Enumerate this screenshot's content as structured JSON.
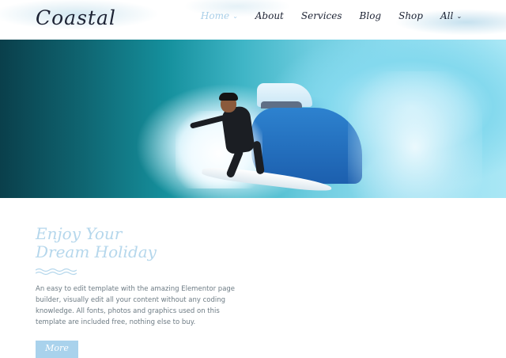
{
  "header": {
    "logo": "Coastal",
    "nav": [
      {
        "label": "Home",
        "active": true,
        "has_dropdown": true
      },
      {
        "label": "About",
        "active": false,
        "has_dropdown": false
      },
      {
        "label": "Services",
        "active": false,
        "has_dropdown": false
      },
      {
        "label": "Blog",
        "active": false,
        "has_dropdown": false
      },
      {
        "label": "Shop",
        "active": false,
        "has_dropdown": false
      },
      {
        "label": "All",
        "active": false,
        "has_dropdown": true
      }
    ]
  },
  "hero": {
    "image": "surfer-in-wave-barrel-image"
  },
  "content": {
    "title_line1": "Enjoy Your",
    "title_line2": "Dream Holiday",
    "description": "An easy to edit template with the amazing Elementor page builder, visually edit all your content without any coding knowledge. All fonts, photos and graphics used on this template are included free, nothing else to buy.",
    "button_label": "More"
  },
  "colors": {
    "accent": "#a9d2ec",
    "text_dark": "#1c2233",
    "text_body": "#6d7b84",
    "nav_active": "#a9cfe8"
  }
}
